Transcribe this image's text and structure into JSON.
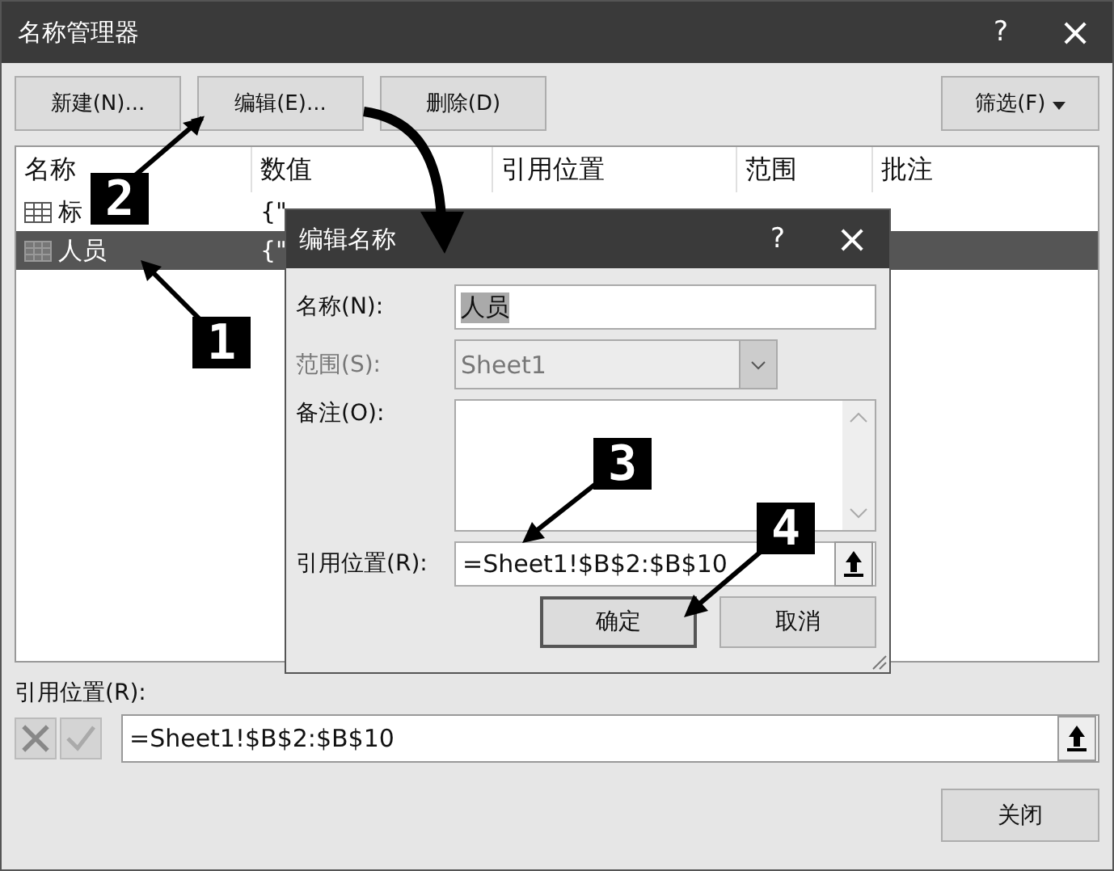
{
  "window": {
    "title": "名称管理器",
    "help": "?",
    "close": "×"
  },
  "toolbar": {
    "buttons": [
      "新建(N)...",
      "编辑(E)...",
      "删除(D)"
    ],
    "filter": "筛选(F)"
  },
  "list": {
    "columns": [
      "名称",
      "数值",
      "引用位置",
      "范围",
      "批注"
    ],
    "rows": [
      {
        "name": "标",
        "value": "{\"",
        "selected": false
      },
      {
        "name": "人员",
        "value": "{\"",
        "selected": true
      }
    ]
  },
  "dialog": {
    "title": "编辑名称",
    "help": "?",
    "close": "×",
    "name_label": "名称(N):",
    "name_value": "人员",
    "scope_label": "范围(S):",
    "scope_value": "Sheet1",
    "scope_disabled": true,
    "comment_label": "备注(O):",
    "refers_label": "引用位置(R):",
    "refers_value": "=Sheet1!$B$2:$B$10",
    "buttons": [
      {
        "label": "确定",
        "default": true
      },
      {
        "label": "取消",
        "default": false
      }
    ]
  },
  "refers_to": {
    "label": "引用位置(R):",
    "value": "=Sheet1!$B$2:$B$10"
  },
  "close_button": "关闭",
  "markers": [
    {
      "label": "1"
    },
    {
      "label": "2"
    },
    {
      "label": "3"
    },
    {
      "label": "4"
    }
  ]
}
